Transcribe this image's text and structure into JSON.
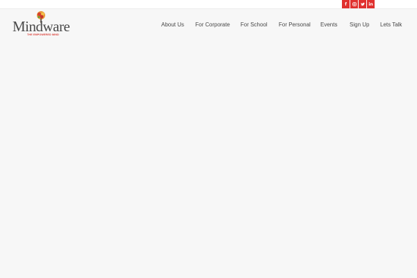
{
  "social": {
    "facebook": "f",
    "instagram": "instagram-icon",
    "twitter": "twitter-icon",
    "linkedin": "in",
    "color": "#e0312f"
  },
  "logo": {
    "wordmark": "Mindware",
    "tagline": "THE EMPOWERED MIND"
  },
  "nav": {
    "about": "About Us",
    "corporate": "For Corporate",
    "school": "For School",
    "personal": "For Personal",
    "events": "Events",
    "signup": "Sign Up",
    "talk": "Lets Talk"
  },
  "colors": {
    "background": "#f7f7f7",
    "accent": "#e0312f",
    "nav_text": "#474747"
  }
}
